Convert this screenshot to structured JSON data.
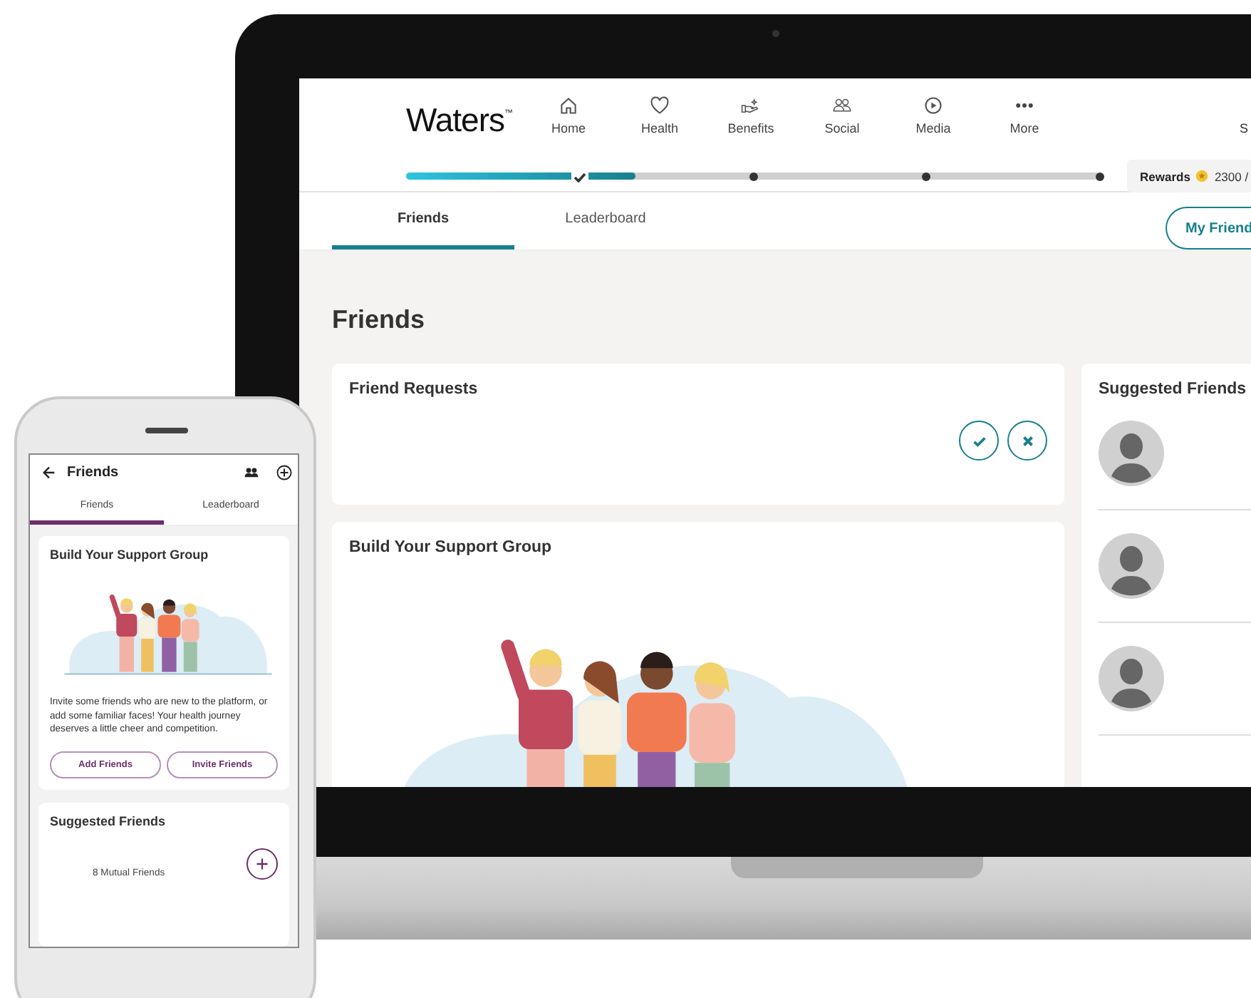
{
  "laptop": {
    "logo": "Waters",
    "logo_mark": "™",
    "nav": [
      {
        "label": "Home",
        "kind": "home"
      },
      {
        "label": "Health",
        "kind": "health"
      },
      {
        "label": "Benefits",
        "kind": "benefits"
      },
      {
        "label": "Social",
        "kind": "social"
      },
      {
        "label": "Media",
        "kind": "media"
      },
      {
        "label": "More",
        "kind": "more"
      }
    ],
    "nav_cut_text": "S",
    "progress": {
      "level": 0.33,
      "milestones": [
        {
          "done": true
        },
        {
          "done": false
        },
        {
          "done": false
        },
        {
          "done": false
        }
      ]
    },
    "rewards": {
      "label": "Rewards",
      "points": "2300 /"
    },
    "tabs": [
      {
        "label": "Friends",
        "selected": true
      },
      {
        "label": "Leaderboard",
        "selected": false
      }
    ],
    "my_friends_button": "My Friend",
    "page_title": "Friends",
    "friend_requests": {
      "title": "Friend Requests"
    },
    "build_group": {
      "title": "Build Your Support Group"
    },
    "suggested": {
      "title": "Suggested Friends",
      "people": [
        {
          "kind": "placeholder"
        },
        {
          "kind": "placeholder"
        },
        {
          "kind": "placeholder"
        }
      ]
    }
  },
  "phone": {
    "title": "Friends",
    "tabs": [
      {
        "label": "Friends",
        "selected": true
      },
      {
        "label": "Leaderboard",
        "selected": false
      }
    ],
    "build_group": {
      "title": "Build Your Support Group",
      "text": "Invite some friends who are new to the platform, or add some familiar faces! Your health journey deserves a little cheer and competition.",
      "buttons": [
        "Add Friends",
        "Invite Friends"
      ]
    },
    "suggested": {
      "title": "Suggested Friends",
      "people": [
        {
          "mutual": "8 Mutual Friends"
        }
      ]
    }
  }
}
